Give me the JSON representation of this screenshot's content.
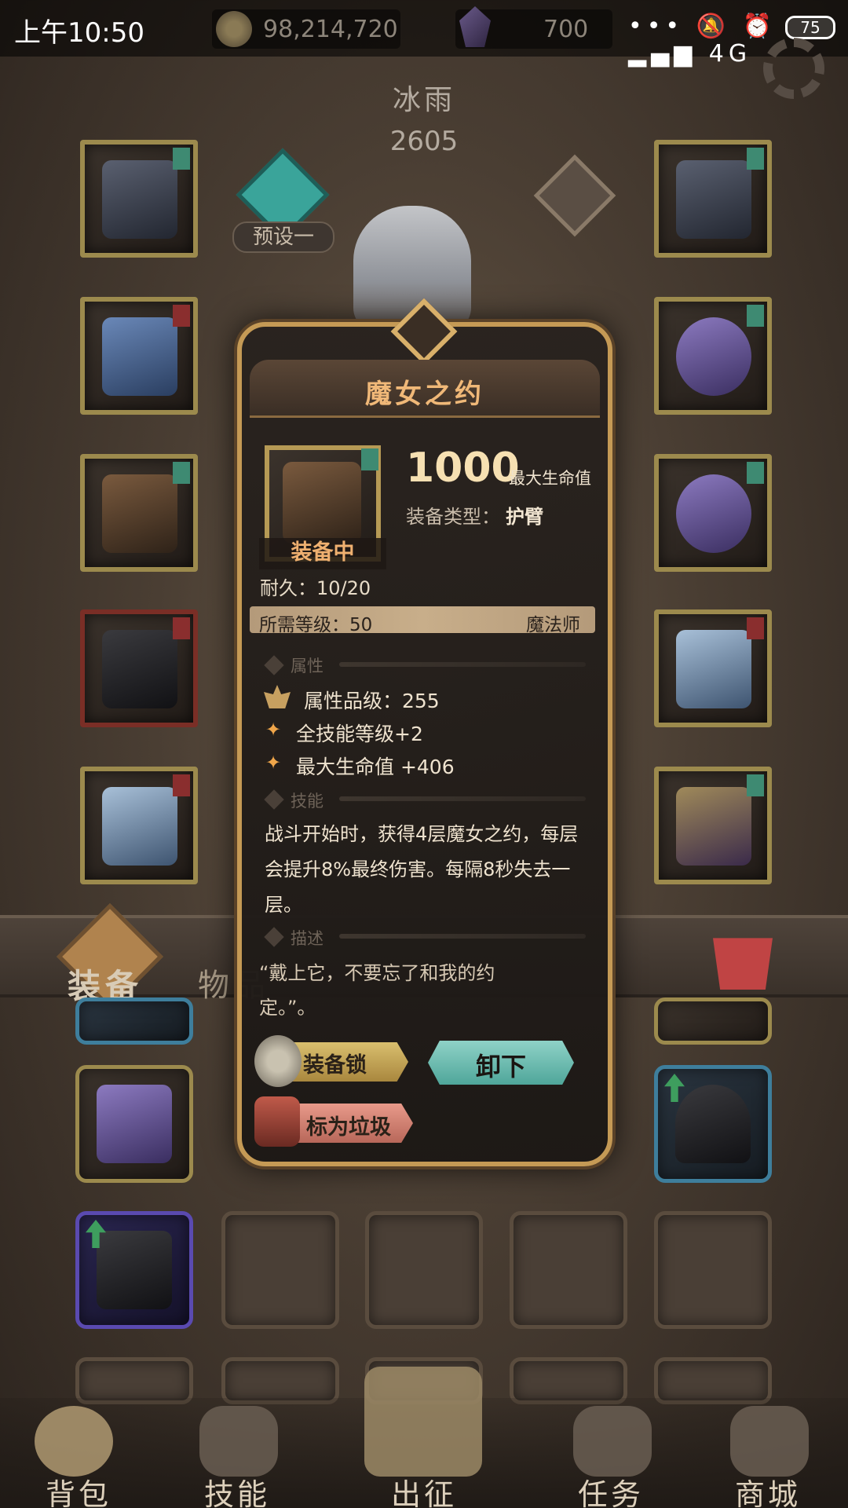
{
  "status_bar": {
    "time": "上午10:50",
    "gold": "98,214,720",
    "gems": "700",
    "right_icons": "••• 🔕 ⏰ ▂▄▆ 4G",
    "battery": "75"
  },
  "character": {
    "name": "冰雨",
    "power": "2605",
    "preset_label": "预设一"
  },
  "tabs": {
    "equipment": "装备",
    "items": "物品"
  },
  "bottom_nav": {
    "backpack": "背包",
    "skills": "技能",
    "expedition": "出征",
    "quests": "任务",
    "shop": "商城"
  },
  "item": {
    "title": "魔女之约",
    "equipped_label": "装备中",
    "stat_value": "1000",
    "stat_label": "最大生命值",
    "equip_type_label": "装备类型：",
    "equip_type_value": "护臂",
    "durability": "耐久：10/20",
    "level_requirement": "所需等级：50",
    "class_requirement": "魔法师",
    "sections": {
      "attributes": "属性",
      "skill": "技能",
      "description": "描述"
    },
    "attribute_grade": "属性品级：255",
    "attributes": [
      "全技能等级+2",
      "最大生命值 +406"
    ],
    "skill_text": "战斗开始时，获得4层魔女之约，每层会提升8%最终伤害。每隔8秒失去一层。",
    "description": "“戴上它，不要忘了和我的约定。”。",
    "buttons": {
      "lock": "装备锁",
      "unequip": "卸下",
      "junk": "标为垃圾"
    }
  },
  "colors": {
    "title": "#f0b878",
    "accent_teal": "#4fa69a",
    "frame_gold": "#c59a55"
  }
}
